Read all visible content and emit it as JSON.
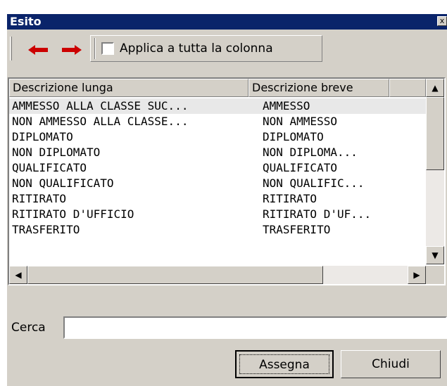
{
  "window": {
    "title": "Esito",
    "close_label": "x"
  },
  "toolbar": {
    "prev_icon": "arrow-left-icon",
    "next_icon": "arrow-right-icon",
    "apply_all_label": "Applica a tutta la colonna",
    "apply_all_checked": false
  },
  "list": {
    "columns": [
      "Descrizione lunga",
      "Descrizione breve"
    ],
    "rows": [
      [
        "AMMESSO ALLA CLASSE SUC...",
        "AMMESSO"
      ],
      [
        "NON AMMESSO ALLA CLASSE...",
        "NON AMMESSO"
      ],
      [
        "DIPLOMATO",
        "DIPLOMATO"
      ],
      [
        "NON DIPLOMATO",
        "NON DIPLOMA..."
      ],
      [
        "QUALIFICATO",
        "QUALIFICATO"
      ],
      [
        "NON QUALIFICATO",
        "NON QUALIFIC..."
      ],
      [
        "RITIRATO",
        "RITIRATO"
      ],
      [
        "RITIRATO D'UFFICIO",
        "RITIRATO D'UF..."
      ],
      [
        "TRASFERITO",
        "TRASFERITO"
      ]
    ],
    "selected_index": 0
  },
  "search": {
    "label": "Cerca",
    "value": ""
  },
  "buttons": {
    "assign_label": "Assegna",
    "close_label": "Chiudi"
  },
  "colors": {
    "titlebar": "#0a246a",
    "face": "#d4d0c8",
    "arrow": "#cc0000"
  }
}
